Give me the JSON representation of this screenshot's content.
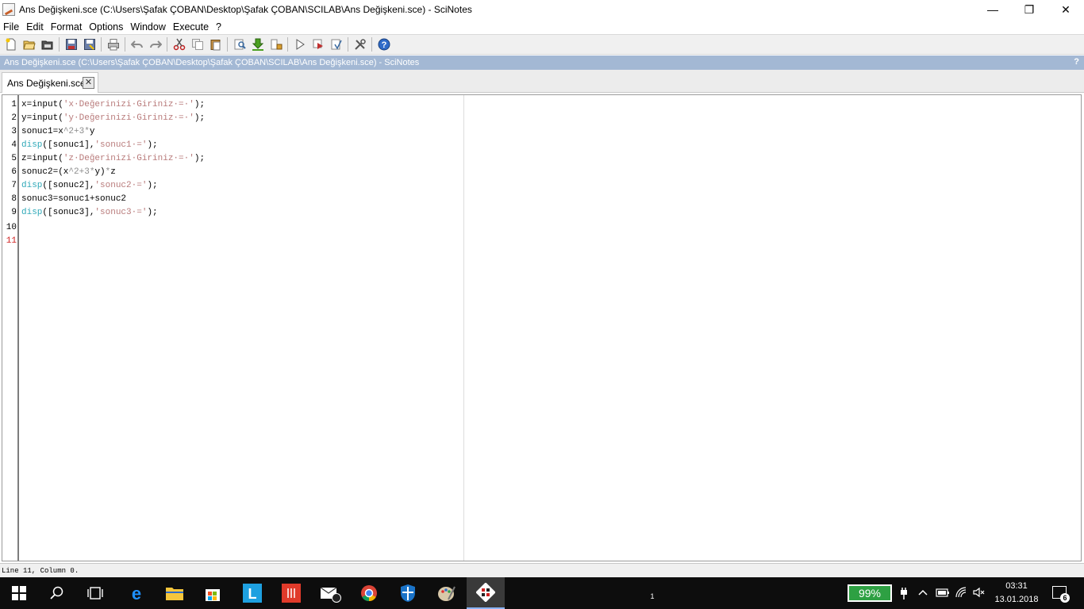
{
  "window": {
    "title": "Ans Değişkeni.sce (C:\\Users\\Şafak ÇOBAN\\Desktop\\Şafak ÇOBAN\\SCILAB\\Ans Değişkeni.sce) - SciNotes",
    "minimize": "—",
    "restore": "❐",
    "close": "✕"
  },
  "menu": {
    "items": [
      "File",
      "Edit",
      "Format",
      "Options",
      "Window",
      "Execute",
      "?"
    ]
  },
  "toolbar": {
    "icons": [
      "new-file-icon",
      "open-file-icon",
      "open-folder-icon",
      "save-icon",
      "save-as-icon",
      "print-icon",
      "undo-icon",
      "redo-icon",
      "cut-icon",
      "copy-icon",
      "paste-icon",
      "find-replace-icon",
      "load-into-scilab-icon",
      "execute-file-icon",
      "execute-icon",
      "execute-until-caret-icon",
      "execute-selection-icon",
      "tools-icon",
      "help-icon"
    ]
  },
  "doc_header": {
    "text": "Ans Değişkeni.sce (C:\\Users\\Şafak ÇOBAN\\Desktop\\Şafak ÇOBAN\\SCILAB\\Ans Değişkeni.sce) - SciNotes",
    "help": "?"
  },
  "tab": {
    "label": "Ans Değişkeni.sce",
    "close": "✕"
  },
  "editor": {
    "line_numbers": [
      "1",
      "2",
      "3",
      "4",
      "5",
      "6",
      "7",
      "8",
      "9",
      "10",
      "11"
    ],
    "current_line": "11",
    "lines": [
      [
        {
          "t": "x=input(",
          "c": ""
        },
        {
          "t": "'x·Değerinizi·Giriniz·=·'",
          "c": "str"
        },
        {
          "t": ");",
          "c": ""
        }
      ],
      [
        {
          "t": "y=input(",
          "c": ""
        },
        {
          "t": "'y·Değerinizi·Giriniz·=·'",
          "c": "str"
        },
        {
          "t": ");",
          "c": ""
        }
      ],
      [
        {
          "t": "sonuc1=x",
          "c": ""
        },
        {
          "t": "^2+3*",
          "c": "num"
        },
        {
          "t": "y",
          "c": ""
        }
      ],
      [
        {
          "t": "disp",
          "c": "kw"
        },
        {
          "t": "([sonuc1],",
          "c": ""
        },
        {
          "t": "'sonuc1·='",
          "c": "str"
        },
        {
          "t": ");",
          "c": ""
        }
      ],
      [
        {
          "t": "z=input(",
          "c": ""
        },
        {
          "t": "'z·Değerinizi·Giriniz·=·'",
          "c": "str"
        },
        {
          "t": ");",
          "c": ""
        }
      ],
      [
        {
          "t": "sonuc2=(x",
          "c": ""
        },
        {
          "t": "^2+3*",
          "c": "num"
        },
        {
          "t": "y)",
          "c": ""
        },
        {
          "t": "*",
          "c": "num"
        },
        {
          "t": "z",
          "c": ""
        }
      ],
      [
        {
          "t": "disp",
          "c": "kw"
        },
        {
          "t": "([sonuc2],",
          "c": ""
        },
        {
          "t": "'sonuc2·='",
          "c": "str"
        },
        {
          "t": ");",
          "c": ""
        }
      ],
      [
        {
          "t": "sonuc3=sonuc1+sonuc2",
          "c": ""
        }
      ],
      [
        {
          "t": "disp",
          "c": "kw"
        },
        {
          "t": "([sonuc3],",
          "c": ""
        },
        {
          "t": "'sonuc3·='",
          "c": "str"
        },
        {
          "t": ");",
          "c": ""
        }
      ],
      [],
      []
    ]
  },
  "status": {
    "text": "Line 11, Column 0."
  },
  "taskbar": {
    "battery": "99%",
    "time": "03:31",
    "date": "13.01.2018",
    "notifications": "6",
    "mail_badge": "1"
  },
  "colors": {
    "string": "#b87a7a",
    "keyword": "#2ea8b8",
    "number": "#8c8c8c",
    "current_line": "#d02020"
  }
}
